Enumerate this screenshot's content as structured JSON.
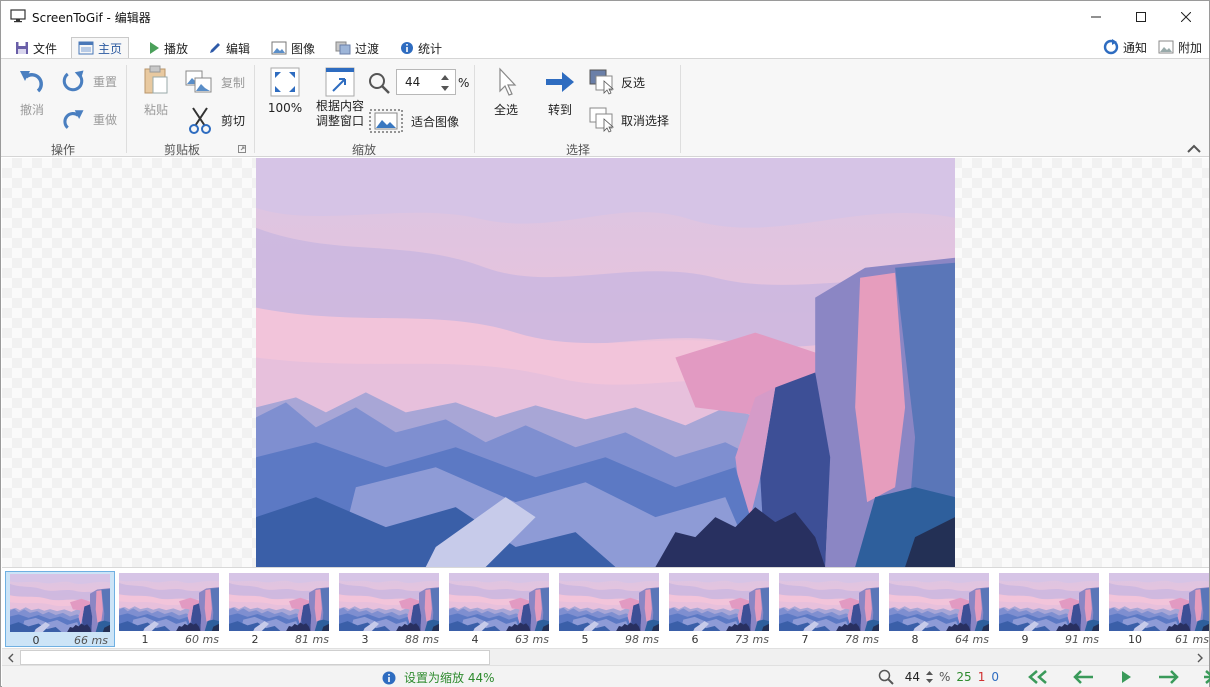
{
  "window": {
    "title": "ScreenToGif - 编辑器"
  },
  "tabs": [
    {
      "label": "文件"
    },
    {
      "label": "主页"
    },
    {
      "label": "播放"
    },
    {
      "label": "编辑"
    },
    {
      "label": "图像"
    },
    {
      "label": "过渡"
    },
    {
      "label": "统计"
    }
  ],
  "top_right": {
    "notify": "通知",
    "extras": "附加"
  },
  "ribbon": {
    "actions": {
      "undo": "撤消",
      "reset": "重置",
      "redo": "重做",
      "label": "操作"
    },
    "clipboard": {
      "paste": "粘贴",
      "copy": "复制",
      "cut": "剪切",
      "label": "剪贴板"
    },
    "zoom": {
      "zoom100": "100%",
      "fit_content_line1": "根据内容",
      "fit_content_line2": "调整窗口",
      "value": "44",
      "percent": "%",
      "fit_image": "适合图像",
      "label": "缩放"
    },
    "select": {
      "select_all": "全选",
      "goto": "转到",
      "inverse": "反选",
      "deselect": "取消选择",
      "label": "选择"
    }
  },
  "frames": [
    {
      "index": "0",
      "duration": "66 ms"
    },
    {
      "index": "1",
      "duration": "60 ms"
    },
    {
      "index": "2",
      "duration": "81 ms"
    },
    {
      "index": "3",
      "duration": "88 ms"
    },
    {
      "index": "4",
      "duration": "63 ms"
    },
    {
      "index": "5",
      "duration": "98 ms"
    },
    {
      "index": "6",
      "duration": "73 ms"
    },
    {
      "index": "7",
      "duration": "78 ms"
    },
    {
      "index": "8",
      "duration": "64 ms"
    },
    {
      "index": "9",
      "duration": "91 ms"
    },
    {
      "index": "10",
      "duration": "61 ms"
    }
  ],
  "status": {
    "message": "设置为缩放 44%",
    "zoom_value": "44",
    "percent": "%",
    "total_frames": "25",
    "selected_frames": "1",
    "current_frame": "0"
  },
  "colors": {
    "accent_blue": "#2b5aa0",
    "status_green": "#2e8b2e",
    "count_red": "#d03030",
    "nav_green": "#3a9a5a"
  }
}
